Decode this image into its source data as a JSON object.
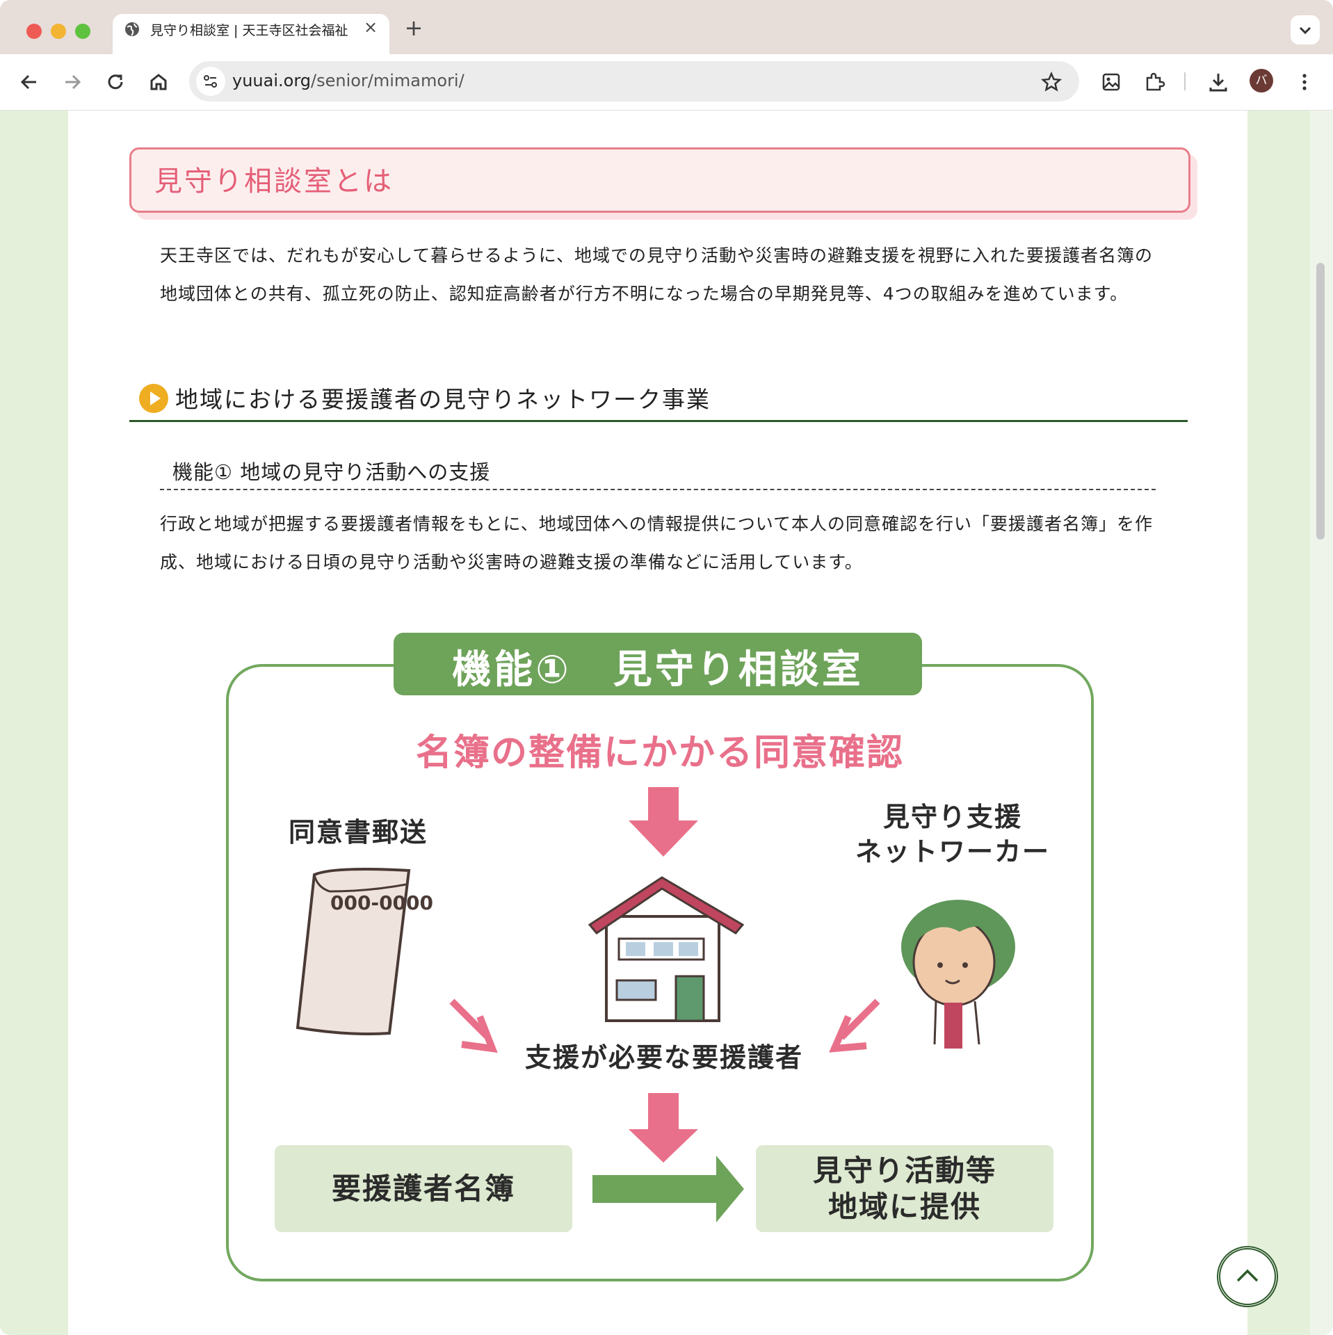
{
  "browser": {
    "tab_title": "見守り相談室 | 天王寺区社会福祉",
    "url_host": "yuuai.org",
    "url_path": "/senior/mimamori/",
    "avatar_initial": "バ"
  },
  "page": {
    "heading": "見守り相談室とは",
    "intro": "天王寺区では、だれもが安心して暮らせるように、地域での見守り活動や災害時の避難支援を視野に入れた要援護者名簿の地域団体との共有、孤立死の防止、認知症高齢者が行方不明になった場合の早期発見等、4つの取組みを進めています。",
    "section_title": "地域における要援護者の見守りネットワーク事業",
    "sub_title": "機能① 地域の見守り活動への支援",
    "sub_text": "行政と地域が把握する要援護者情報をもとに、地域団体への情報提供について本人の同意確認を行い「要援護者名簿」を作成、地域における日頃の見守り活動や災害時の避難支援の準備などに活用しています。"
  },
  "diagram": {
    "banner": "機能①　見守り相談室",
    "subtitle": "名簿の整備にかかる同意確認",
    "mail_label": "同意書郵送",
    "envelope_text": "000-0000",
    "worker_label_1": "見守り支援",
    "worker_label_2": "ネットワーカー",
    "need_label": "支援が必要な要援護者",
    "box1": "要援護者名簿",
    "box2_line1": "見守り活動等",
    "box2_line2": "地域に提供",
    "colors": {
      "green": "#6ea35a",
      "pink": "#e9708a",
      "box": "#dde9d0"
    }
  },
  "icons": [
    "back-icon",
    "forward-icon",
    "reload-icon",
    "home-icon",
    "site-info-icon",
    "star-icon",
    "image-icon",
    "extensions-icon",
    "download-icon",
    "more-icon",
    "chevron-up-icon"
  ]
}
